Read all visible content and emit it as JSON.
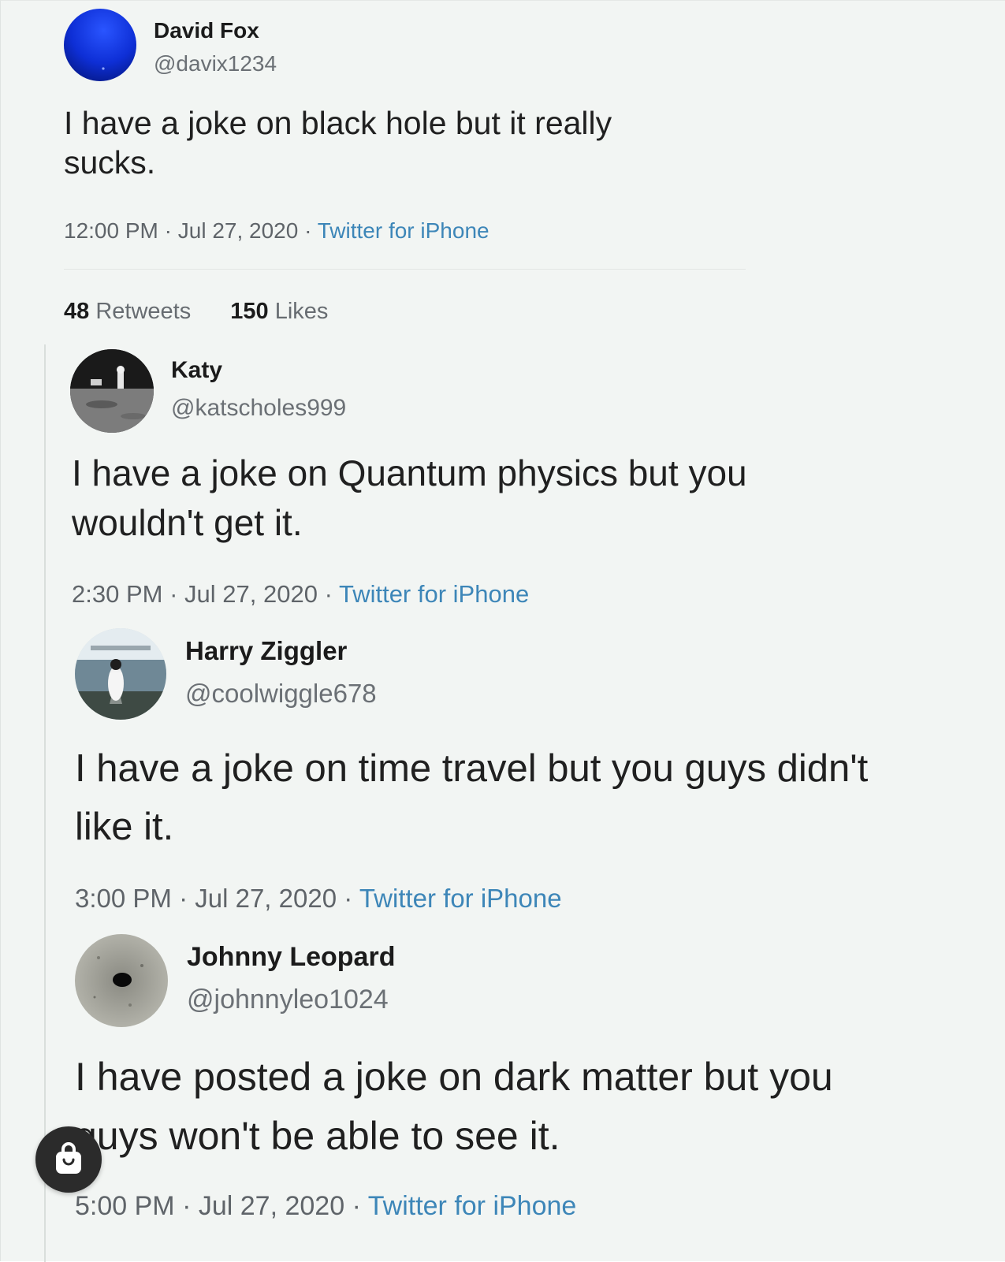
{
  "main_tweet": {
    "name": "David Fox",
    "handle": "@davix1234",
    "text": "I have a joke on black hole but it really sucks.",
    "time": "12:00 PM",
    "date": "Jul 27, 2020",
    "source": "Twitter for iPhone",
    "retweets_count": "48",
    "retweets_label": "Retweets",
    "likes_count": "150",
    "likes_label": "Likes",
    "avatar_icon": "blue-sphere-avatar"
  },
  "replies": [
    {
      "name": "Katy",
      "handle": "@katscholes999",
      "text": "I have a joke on Quantum physics but you wouldn't get it.",
      "time": "2:30 PM",
      "date": "Jul 27, 2020",
      "source": "Twitter for iPhone",
      "avatar_icon": "moon-landing-avatar"
    },
    {
      "name": "Harry Ziggler",
      "handle": "@coolwiggle678",
      "text": "I have a joke on time travel but you guys didn't like it.",
      "time": "3:00 PM",
      "date": "Jul 27, 2020",
      "source": "Twitter for iPhone",
      "avatar_icon": "penguin-avatar"
    },
    {
      "name": "Johnny Leopard",
      "handle": "@johnnyleo1024",
      "text": "I have posted a joke on dark matter but you guys won't be able to see it.",
      "time": "5:00 PM",
      "date": "Jul 27, 2020",
      "source": "Twitter for iPhone",
      "avatar_icon": "dark-hole-avatar"
    }
  ],
  "meta_separator": "·",
  "overlay": {
    "icon": "shopping-bag-icon"
  },
  "colors": {
    "background": "#f2f5f3",
    "source_link": "#3d86b8",
    "meta_text": "#5f6469",
    "avatar_blue": "#1030d8"
  }
}
